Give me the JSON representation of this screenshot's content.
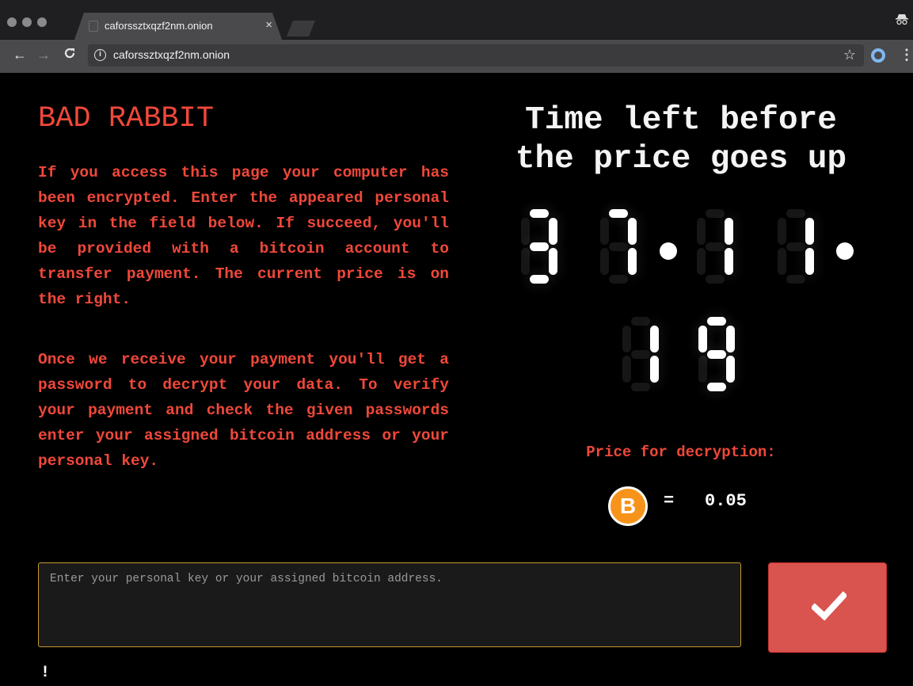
{
  "browser": {
    "tab_title": "caforssztxqzf2nm.onion",
    "tab_close": "×",
    "url": "caforssztxqzf2nm.onion"
  },
  "page": {
    "brand": "BAD RABBIT",
    "paragraph1": "If you access this page your computer has been encrypted. Enter the appeared personal key in the field below. If succeed, you'll be provided with a bitcoin account to transfer payment. The current price is on the right.",
    "paragraph2": "Once we receive your payment you'll get a password to decrypt your data. To verify your payment and check the given passwords enter your assigned bitcoin address or your personal key.",
    "countdown_title_line1": "Time left before",
    "countdown_title_line2": "the price goes up",
    "countdown": {
      "hours": "37",
      "minutes": "11",
      "seconds": "19"
    },
    "price_label": "Price for decryption:",
    "currency_symbol": "B",
    "equals": "=",
    "price": "0.05",
    "input_placeholder": "Enter your personal key or your assigned bitcoin address.",
    "warning": "!"
  },
  "icons": {
    "back": "arrow-left-icon",
    "forward": "arrow-right-icon",
    "reload": "reload-icon",
    "info": "info-icon",
    "star": "star-icon",
    "menu": "kebab-menu-icon",
    "incognito": "incognito-icon",
    "bitcoin": "bitcoin-icon",
    "check": "check-icon"
  },
  "colors": {
    "accent_red": "#f0483a",
    "button_red": "#d9534f",
    "bitcoin_orange": "#f7931a",
    "input_border": "#c49a2c"
  }
}
